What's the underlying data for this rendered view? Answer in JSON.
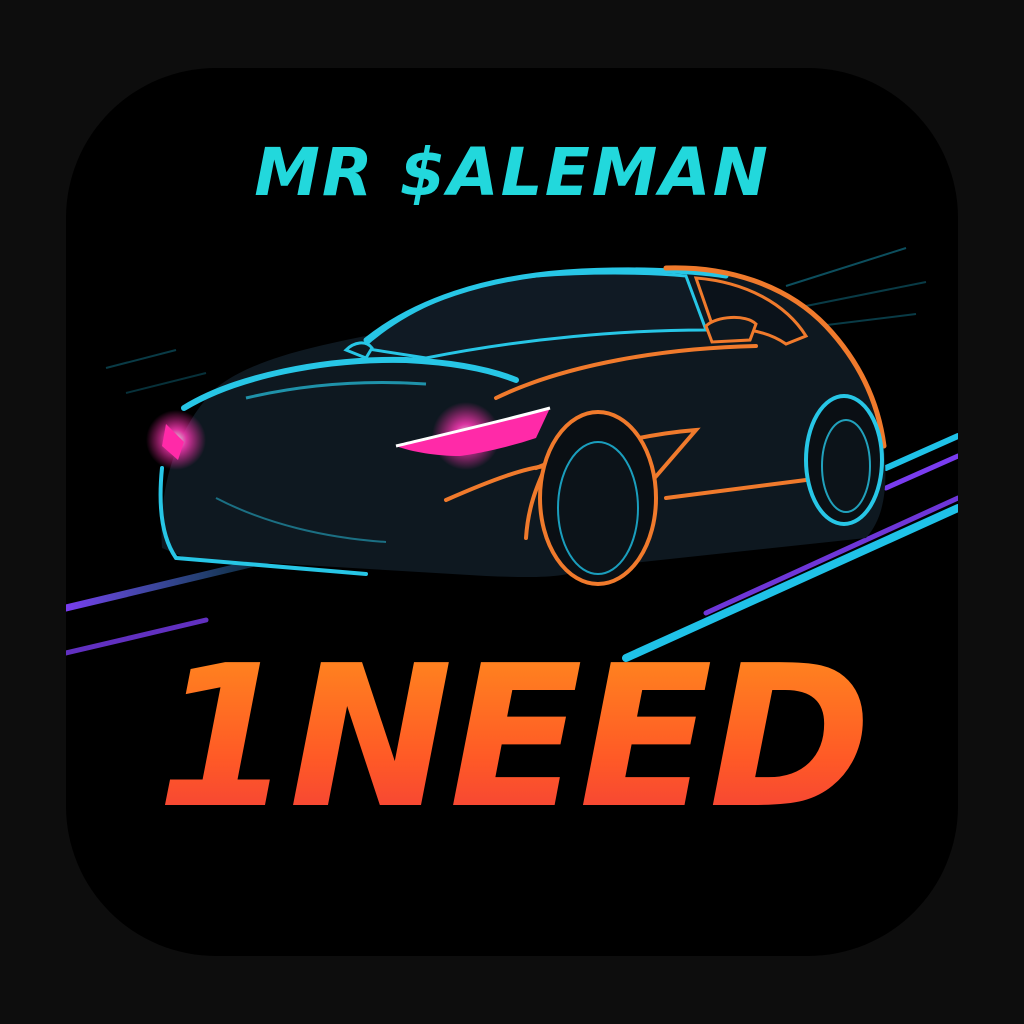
{
  "app_icon": {
    "top_text": "MR $ALEMAN",
    "bottom_text": "1NEED",
    "icon_subject": "sports-car-icon",
    "colors": {
      "background": "#000000",
      "top_text": "#22d8dc",
      "bottom_text_gradient": [
        "#ff8a1e",
        "#ff5a26",
        "#f23d3a"
      ],
      "car_outline_front": "#27c6e6",
      "car_outline_rear": "#f07a2c",
      "headlights": "#ff2aa8",
      "speed_lines": [
        "#1fc2e8",
        "#7a3cf0"
      ]
    }
  }
}
